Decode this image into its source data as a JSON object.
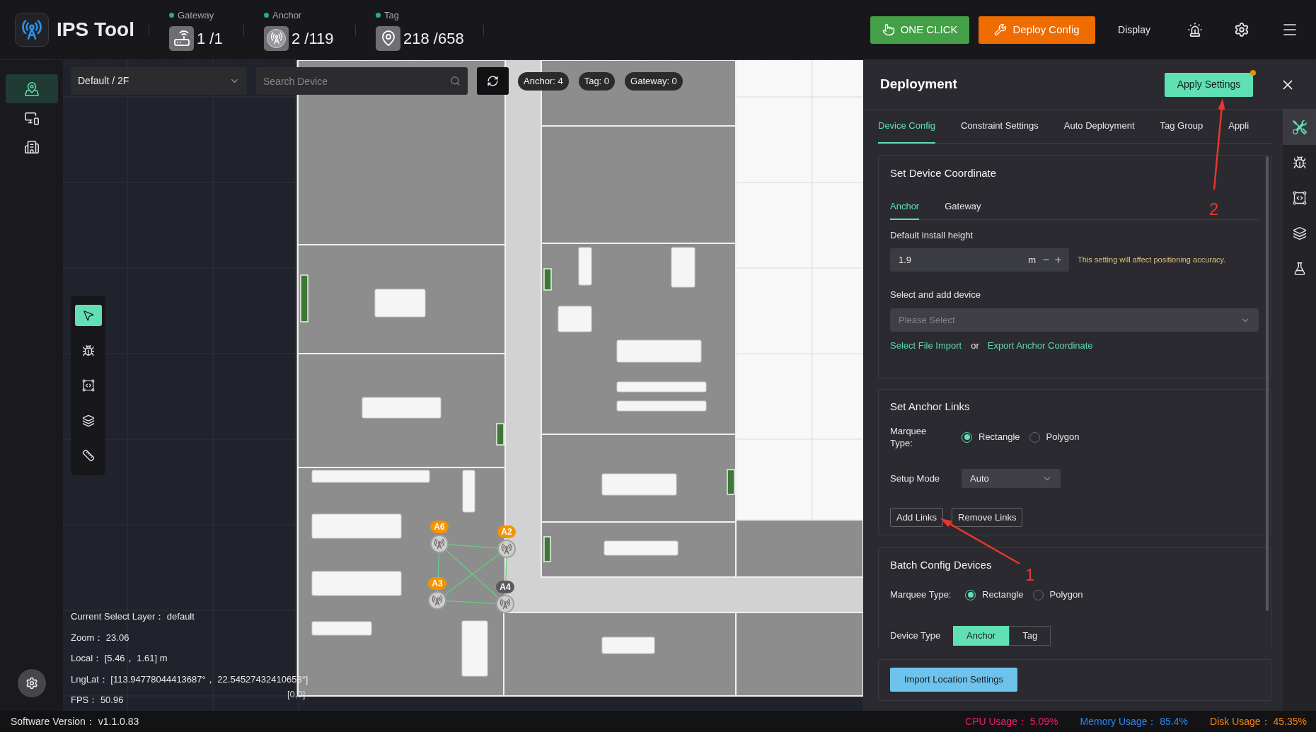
{
  "app": {
    "title": "IPS Tool"
  },
  "stats": [
    {
      "kind": "gateway",
      "label": "Gateway",
      "value": "1 /1"
    },
    {
      "kind": "anchor",
      "label": "Anchor",
      "value": "2 /119"
    },
    {
      "kind": "tag",
      "label": "Tag",
      "value": "218 /658"
    }
  ],
  "toolbar": {
    "one_click": "ONE CLICK",
    "deploy_config": "Deploy Config",
    "display": "Display"
  },
  "nav": [
    {
      "kind": "map",
      "selected": true
    },
    {
      "kind": "devices",
      "selected": false
    },
    {
      "kind": "building",
      "selected": false
    }
  ],
  "map": {
    "floor_select": "Default / 2F",
    "search": {
      "placeholder": "Search Device"
    },
    "counts": [
      "Anchor: 4",
      "Tag: 0",
      "Gateway: 0"
    ],
    "tools": [
      {
        "kind": "pointer",
        "selected": true
      },
      {
        "kind": "bug",
        "selected": false
      },
      {
        "kind": "bounding-box",
        "selected": false
      },
      {
        "kind": "layers",
        "selected": false
      },
      {
        "kind": "ruler",
        "selected": false
      }
    ],
    "anchors": [
      {
        "label": "A6",
        "selected": true
      },
      {
        "label": "A2",
        "selected": true
      },
      {
        "label": "A3",
        "selected": true
      },
      {
        "label": "A4",
        "selected": false
      }
    ],
    "info": [
      "Current Select Layer： default",
      "Zoom： 23.06",
      "Local： [5.46， 1.61] m",
      "LngLat： [113.94778044413687°， 22.54527432410653°]",
      "FPS： 50.96"
    ],
    "origin": "[0,0]"
  },
  "panel": {
    "title": "Deployment",
    "apply_button": {
      "label": "Apply Settings",
      "pending": true
    },
    "tabs": [
      {
        "label": "Device Config",
        "selected": true
      },
      {
        "label": "Constraint Settings",
        "selected": false
      },
      {
        "label": "Auto Deployment",
        "selected": false
      },
      {
        "label": "Tag Group",
        "selected": false
      },
      {
        "label": "Appli",
        "selected": false
      }
    ],
    "tools": [
      {
        "kind": "tools",
        "selected": true
      },
      {
        "kind": "bug",
        "selected": false
      },
      {
        "kind": "bounding-box",
        "selected": false
      },
      {
        "kind": "layers",
        "selected": false
      },
      {
        "kind": "flask",
        "selected": false
      }
    ],
    "device_coordinate": {
      "title": "Set Device Coordinate",
      "tabs": [
        {
          "label": "Anchor",
          "selected": true
        },
        {
          "label": "Gateway",
          "selected": false
        }
      ],
      "height_label": "Default install height",
      "height_value": "1.9",
      "height_unit": "m",
      "height_hint": "This setting will affect positioning accuracy.",
      "device_label": "Select and add device",
      "device_select": {
        "placeholder": "Please Select"
      },
      "import_link": "Select File Import",
      "or": "or",
      "export_link": "Export Anchor Coordinate"
    },
    "anchor_links": {
      "title": "Set Anchor Links",
      "marquee_label": "Marquee Type:",
      "marquee_options": [
        {
          "label": "Rectangle",
          "selected": true
        },
        {
          "label": "Polygon",
          "selected": false
        }
      ],
      "mode_label": "Setup Mode",
      "mode_value": "Auto",
      "buttons": [
        "Add Links",
        "Remove Links"
      ]
    },
    "batch_config": {
      "title": "Batch Config Devices",
      "marquee_label": "Marquee Type:",
      "marquee_options": [
        {
          "label": "Rectangle",
          "selected": true
        },
        {
          "label": "Polygon",
          "selected": false
        }
      ],
      "device_type_label": "Device Type",
      "device_types": [
        {
          "label": "Anchor",
          "selected": true
        },
        {
          "label": "Tag",
          "selected": false
        }
      ]
    },
    "import_button": "Import Location Settings"
  },
  "annotations": [
    {
      "number": "2"
    },
    {
      "number": "1"
    }
  ],
  "status_bar": {
    "version": "Software Version： v1.1.0.83",
    "metrics": [
      {
        "text": "CPU Usage： 5.09%",
        "color": "#ee1f6a"
      },
      {
        "text": "Memory Usage： 85.4%",
        "color": "#2f86ee"
      },
      {
        "text": "Disk Usage： 45.35%",
        "color": "#f5820f"
      }
    ]
  }
}
